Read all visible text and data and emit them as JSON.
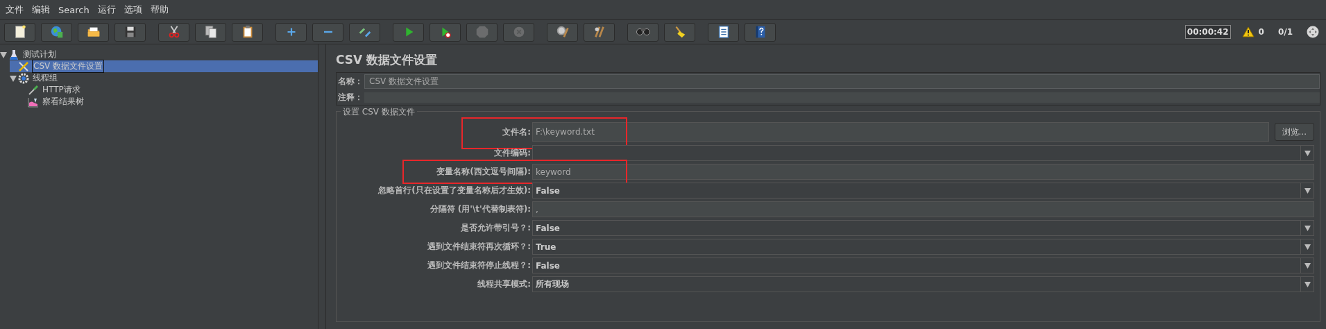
{
  "menu": [
    "文件",
    "编辑",
    "Search",
    "运行",
    "选项",
    "帮助"
  ],
  "toolbar": {
    "groups": [
      [
        {
          "kind": "new",
          "disabled": false
        },
        {
          "kind": "templates",
          "disabled": false
        },
        {
          "kind": "open",
          "disabled": false
        },
        {
          "kind": "save",
          "disabled": false
        }
      ],
      [
        {
          "kind": "cut",
          "disabled": false
        },
        {
          "kind": "copy",
          "disabled": false
        },
        {
          "kind": "paste",
          "disabled": false
        }
      ],
      [
        {
          "kind": "expand",
          "disabled": false
        },
        {
          "kind": "collapse",
          "disabled": false
        },
        {
          "kind": "toggle",
          "disabled": false
        }
      ],
      [
        {
          "kind": "start",
          "disabled": false
        },
        {
          "kind": "start-no-pause",
          "disabled": false
        },
        {
          "kind": "stop",
          "disabled": true
        },
        {
          "kind": "shutdown",
          "disabled": true
        }
      ],
      [
        {
          "kind": "clear",
          "disabled": false
        },
        {
          "kind": "clear-all",
          "disabled": false
        }
      ],
      [
        {
          "kind": "search",
          "disabled": false
        },
        {
          "kind": "reset-search",
          "disabled": false
        }
      ],
      [
        {
          "kind": "functions",
          "disabled": false
        },
        {
          "kind": "help",
          "disabled": false
        }
      ]
    ],
    "timer": "00:00:42",
    "warnings": "0",
    "threads": "0/1"
  },
  "tree": [
    {
      "label": "测试计划",
      "kind": "plan",
      "selected": false,
      "expanded": true,
      "children": [
        {
          "label": "CSV 数据文件设置",
          "kind": "config",
          "selected": true
        },
        {
          "label": "线程组",
          "kind": "threads",
          "selected": false,
          "expanded": true,
          "children": [
            {
              "label": "HTTP请求",
              "kind": "sampler",
              "selected": false
            },
            {
              "label": "察看结果树",
              "kind": "listener",
              "selected": false
            }
          ]
        }
      ]
    }
  ],
  "panel": {
    "title": "CSV 数据文件设置",
    "name_label": "名称：",
    "name_value": "CSV 数据文件设置",
    "comment_label": "注释：",
    "group_title": "设置 CSV 数据文件",
    "rows": [
      {
        "label": "文件名:",
        "kind": "file",
        "value": "F:\\keyword.txt",
        "button": "浏览...",
        "highlighted": true
      },
      {
        "label": "文件编码:",
        "kind": "select",
        "value": "",
        "highlighted": false
      },
      {
        "label": "变量名称(西文逗号间隔):",
        "kind": "text",
        "value": "keyword",
        "highlighted": true
      },
      {
        "label": "忽略首行(只在设置了变量名称后才生效):",
        "kind": "select",
        "value": "False",
        "highlighted": false
      },
      {
        "label": "分隔符 (用'\\t'代替制表符):",
        "kind": "text",
        "value": ",",
        "highlighted": false
      },
      {
        "label": "是否允许带引号？:",
        "kind": "select",
        "value": "False",
        "highlighted": false
      },
      {
        "label": "遇到文件结束符再次循环？:",
        "kind": "select",
        "value": "True",
        "highlighted": false
      },
      {
        "label": "遇到文件结束符停止线程？:",
        "kind": "select",
        "value": "False",
        "highlighted": false
      },
      {
        "label": "线程共享模式:",
        "kind": "select",
        "value": "所有现场",
        "highlighted": false
      }
    ]
  }
}
